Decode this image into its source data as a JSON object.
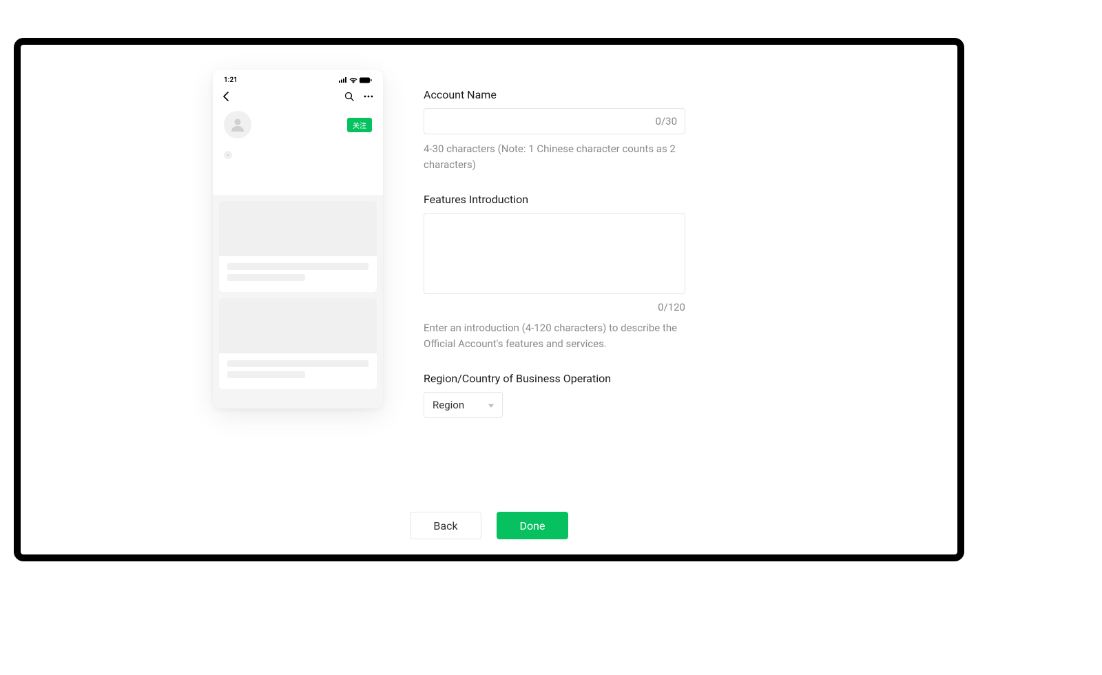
{
  "phone": {
    "time": "1:21",
    "follow_label": "关注"
  },
  "form": {
    "account_name": {
      "label": "Account Name",
      "counter": "0/30",
      "hint": "4-30 characters (Note: 1 Chinese character counts as 2 characters)"
    },
    "features": {
      "label": "Features Introduction",
      "counter": "0/120",
      "hint": "Enter an introduction (4-120 characters) to describe the Official Account's features and services."
    },
    "region": {
      "label": "Region/Country of Business Operation",
      "placeholder": "Region"
    }
  },
  "footer": {
    "back": "Back",
    "done": "Done"
  }
}
